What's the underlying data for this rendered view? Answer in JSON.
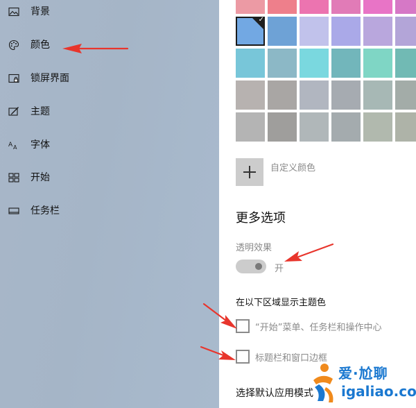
{
  "sidebar": {
    "items": [
      {
        "label": "背景",
        "icon": "picture-icon"
      },
      {
        "label": "颜色",
        "icon": "palette-icon"
      },
      {
        "label": "锁屏界面",
        "icon": "lock-screen-icon"
      },
      {
        "label": "主题",
        "icon": "theme-icon"
      },
      {
        "label": "字体",
        "icon": "font-icon"
      },
      {
        "label": "开始",
        "icon": "start-icon"
      },
      {
        "label": "任务栏",
        "icon": "taskbar-icon"
      }
    ]
  },
  "colors": {
    "swatches": [
      [
        "#ec9aa4",
        "#ee7f8b",
        "#ec74b0",
        "#e17bb7",
        "#e874c6",
        "#d678c6"
      ],
      [
        "#72a8e3",
        "#6ea2d6",
        "#c1c2eb",
        "#aaa9e8",
        "#b9a7dd",
        "#b3a5d8"
      ],
      [
        "#78c6d9",
        "#8cb8c6",
        "#7ad8df",
        "#72b6bb",
        "#7fd6c5",
        "#71bab4"
      ],
      [
        "#b7b2b0",
        "#a9a6a4",
        "#b1b6c0",
        "#a6abb1",
        "#a7b8b5",
        "#a3aca8"
      ],
      [
        "#b4b4b4",
        "#9f9e9c",
        "#b0b7b9",
        "#a4abae",
        "#b1b9ae",
        "#aeb3a8"
      ]
    ],
    "selected_swatch": "row 2, column 1",
    "custom_color_label": "自定义颜色"
  },
  "more_options": {
    "title": "更多选项",
    "transparency_label": "透明效果",
    "transparency_state": "开",
    "accent_surfaces_label": "在以下区域显示主题色",
    "checkboxes": [
      {
        "label": "“开始”菜单、任务栏和操作中心",
        "checked": false
      },
      {
        "label": "标题栏和窗口边框",
        "checked": false
      }
    ],
    "app_mode_label": "选择默认应用模式"
  },
  "theme": {
    "text_primary": "#111111",
    "text_disabled": "#8a8a8a",
    "annotation_arrow": "#e8352c",
    "watermark_blue": "#1a78d0",
    "watermark_orange": "#f08a1c"
  },
  "watermark": {
    "text": "爱·尬聊",
    "domain": "igaliao.com"
  }
}
